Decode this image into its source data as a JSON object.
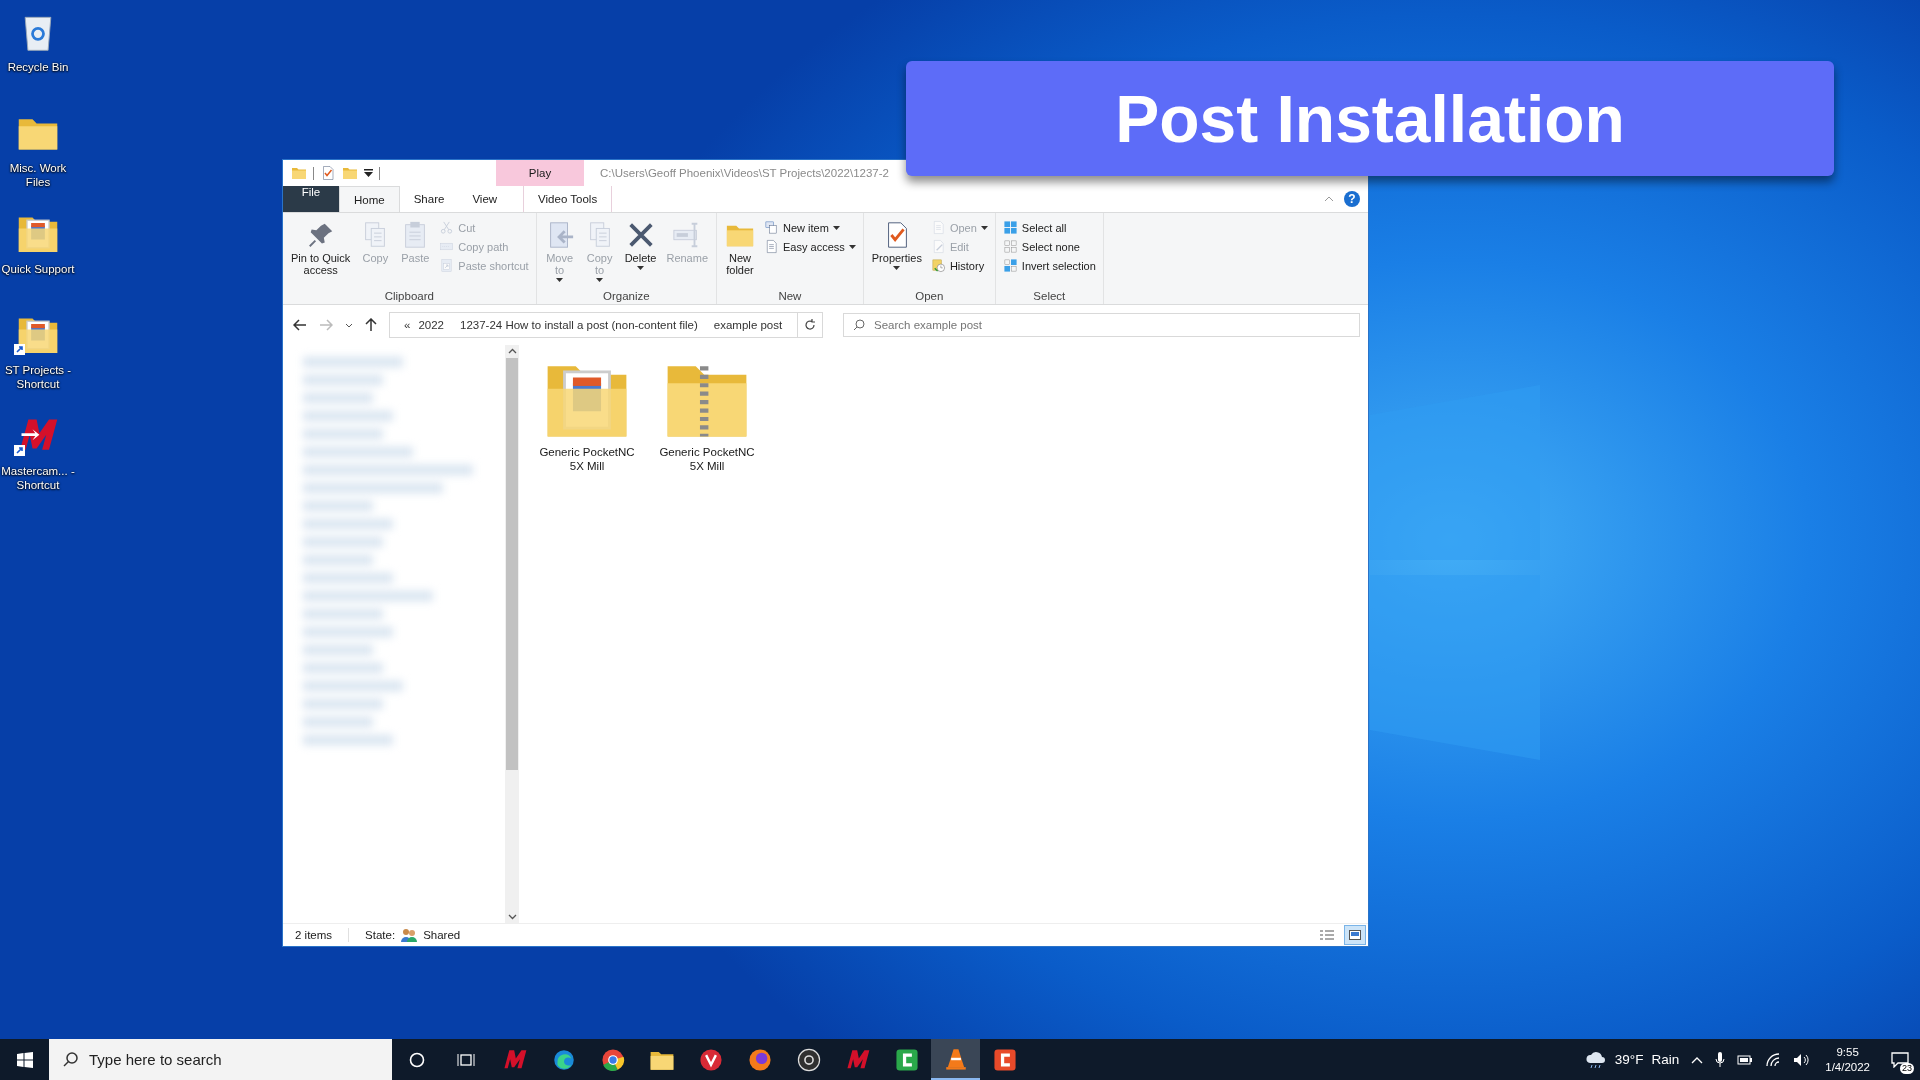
{
  "desktop_icons": [
    {
      "label": "Recycle Bin",
      "kind": "bin",
      "shortcut": false
    },
    {
      "label": "Misc. Work Files",
      "kind": "folder",
      "shortcut": false
    },
    {
      "label": "Quick Support",
      "kind": "doc-folder",
      "shortcut": false
    },
    {
      "label": "ST Projects - Shortcut",
      "kind": "doc-folder",
      "shortcut": true
    },
    {
      "label": "Mastercam... - Shortcut",
      "kind": "m-logo",
      "shortcut": true
    }
  ],
  "banner": {
    "title": "Post Installation"
  },
  "window": {
    "context_tab": "Play",
    "path": "C:\\Users\\Geoff Phoenix\\Videos\\ST Projects\\2022\\1237-2",
    "tabs": [
      {
        "label": "File",
        "kind": "file",
        "selected": false
      },
      {
        "label": "Home",
        "kind": "tab",
        "selected": true
      },
      {
        "label": "Share",
        "kind": "tab",
        "selected": false
      },
      {
        "label": "View",
        "kind": "tab",
        "selected": false
      },
      {
        "label": "Video Tools",
        "kind": "context",
        "selected": false
      }
    ],
    "help": "?",
    "ribbon": [
      {
        "label": "Clipboard",
        "items": [
          {
            "label": "Pin to Quick\naccess",
            "kind": "pin",
            "disabled": false,
            "dropdown": false
          },
          {
            "label": "Copy",
            "kind": "pages",
            "disabled": true,
            "dropdown": false
          },
          {
            "label": "Paste",
            "kind": "clipboard",
            "disabled": true,
            "dropdown": false
          },
          {
            "label": "Cut",
            "kind": "scissors",
            "disabled": true,
            "dropdown": false
          },
          {
            "label": "Copy path",
            "kind": "path",
            "disabled": true,
            "dropdown": false
          },
          {
            "label": "Paste shortcut",
            "kind": "shortcut",
            "disabled": true,
            "dropdown": false
          }
        ]
      },
      {
        "label": "Organize",
        "items": [
          {
            "label": "Move\nto",
            "kind": "move",
            "disabled": true,
            "dropdown": true
          },
          {
            "label": "Copy\nto",
            "kind": "pages",
            "disabled": true,
            "dropdown": true
          },
          {
            "label": "Delete",
            "kind": "delete",
            "disabled": false,
            "dropdown": true
          },
          {
            "label": "Rename",
            "kind": "rename",
            "disabled": true,
            "dropdown": false
          }
        ]
      },
      {
        "label": "New",
        "items": [
          {
            "label": "New\nfolder",
            "kind": "folder",
            "disabled": false,
            "dropdown": false
          },
          {
            "label": "New item",
            "kind": "newitem",
            "disabled": false,
            "dropdown": true
          },
          {
            "label": "Easy access",
            "kind": "page",
            "disabled": false,
            "dropdown": true
          }
        ]
      },
      {
        "label": "Open",
        "items": [
          {
            "label": "Properties",
            "kind": "properties",
            "disabled": false,
            "dropdown": true
          },
          {
            "label": "Open",
            "kind": "page",
            "disabled": true,
            "dropdown": true
          },
          {
            "label": "Edit",
            "kind": "edit",
            "disabled": true,
            "dropdown": false
          },
          {
            "label": "History",
            "kind": "history",
            "disabled": false,
            "dropdown": false
          }
        ]
      },
      {
        "label": "Select",
        "items": [
          {
            "label": "Select all",
            "kind": "grid-all",
            "disabled": false,
            "dropdown": false
          },
          {
            "label": "Select none",
            "kind": "grid-none",
            "disabled": false,
            "dropdown": false
          },
          {
            "label": "Invert selection",
            "kind": "grid-invert",
            "disabled": false,
            "dropdown": false
          }
        ]
      }
    ],
    "nav": {
      "back_disabled": false,
      "forward_disabled": true
    },
    "address": {
      "overflow": "«",
      "crumbs": [
        "2022",
        "1237-24 How to install a post (non-content file)",
        "example post"
      ]
    },
    "search": {
      "placeholder": "Search example post"
    },
    "files": [
      {
        "name": "Generic PocketNC 5X Mill",
        "kind": "doc-folder"
      },
      {
        "name": "Generic PocketNC 5X Mill",
        "kind": "zip"
      }
    ],
    "status": {
      "count": "2 items",
      "state_label": "State:",
      "state": "Shared"
    },
    "views": [
      {
        "kind": "details",
        "selected": false
      },
      {
        "kind": "large-icons",
        "selected": true
      }
    ]
  },
  "taskbar": {
    "search_placeholder": "Type here to search",
    "apps": [
      {
        "kind": "m-logo",
        "active": false
      },
      {
        "kind": "swirl",
        "active": false
      },
      {
        "kind": "tricolor",
        "active": false
      },
      {
        "kind": "folder",
        "active": false
      },
      {
        "kind": "red-circle",
        "active": false
      },
      {
        "kind": "orange-globe",
        "active": false
      },
      {
        "kind": "dark-circle",
        "active": false
      },
      {
        "kind": "m-logo",
        "active": false
      },
      {
        "kind": "green-square",
        "active": false
      },
      {
        "kind": "cone",
        "active": true
      },
      {
        "kind": "red-square",
        "active": false
      }
    ],
    "temperature": "39°F",
    "weather": "Rain",
    "time": "9:55",
    "date": "1/4/2022",
    "notifications": "23"
  }
}
